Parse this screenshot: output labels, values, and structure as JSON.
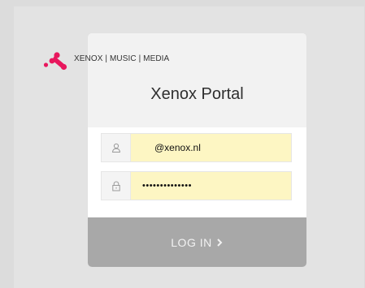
{
  "brand": {
    "logo_text": "XENOX | MUSIC | MEDIA",
    "logo_color": "#e8175d",
    "logo_icon": "xenox-dots-logo-icon"
  },
  "portal": {
    "title": "Xenox Portal"
  },
  "form": {
    "email": {
      "value": "@xenox.nl",
      "icon": "user-icon"
    },
    "password": {
      "value": "••••••••••••••",
      "icon": "lock-icon"
    },
    "autofill_color": "#fdf6c3"
  },
  "login_button": {
    "label": "LOG IN",
    "icon": "chevron-right-icon",
    "color": "#a8a8a8"
  }
}
